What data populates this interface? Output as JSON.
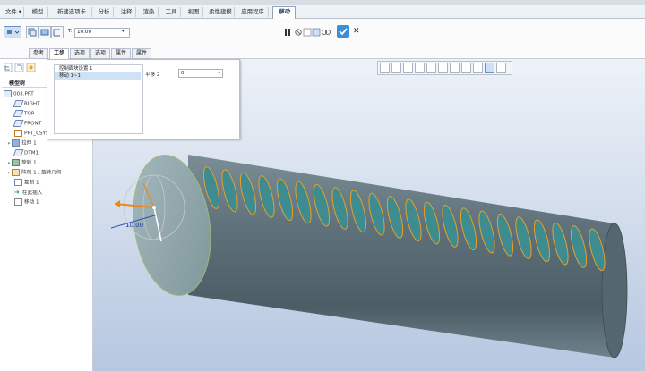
{
  "menubar": {
    "items": [
      "文件 ▾",
      "模型",
      "新建选项卡",
      "分析",
      "注释",
      "渲染",
      "工具",
      "视图",
      "柔性建模",
      "应用程序",
      "移动"
    ]
  },
  "ribbon": {
    "t_label": "T:",
    "t_value": "10.00",
    "subtabs": [
      "参考",
      "选项",
      "选项",
      "选项",
      "属性"
    ],
    "subtabs_visible": [
      "参考",
      "选项",
      "选项",
      "选项",
      "属性"
    ]
  },
  "subtabs": [
    "参考",
    "工步",
    "选项",
    "选项",
    "属性"
  ],
  "motion_panel": {
    "list_items": [
      "控制面块设置 1",
      "移动 1~1"
    ],
    "translate_label": "平移 2",
    "translate_value": "0"
  },
  "model_tree": {
    "title": "模型树",
    "items": [
      {
        "label": "003.PRT",
        "indent": 0
      },
      {
        "label": "RIGHT",
        "indent": 1
      },
      {
        "label": "TOP",
        "indent": 1
      },
      {
        "label": "FRONT",
        "indent": 1
      },
      {
        "label": "PRT_CSYS_DEF",
        "indent": 1
      },
      {
        "label": "拉伸 1",
        "indent": 1
      },
      {
        "label": "DTM1",
        "indent": 1
      },
      {
        "label": "旋转 1",
        "indent": 1
      },
      {
        "label": "阵列 1 / 旋转几何",
        "indent": 1
      },
      {
        "label": "复制 1",
        "indent": 1
      },
      {
        "label": "在此插入",
        "indent": 1
      },
      {
        "label": "移动 1",
        "indent": 1
      }
    ]
  },
  "viewport": {
    "dimension_label": "10.00"
  },
  "colors": {
    "viewport_top": "#e9eef6",
    "viewport_bottom": "#b9c9e2",
    "cylinder_body": "#5b6f78",
    "cylinder_face": "#8fa8ad",
    "slot_fill": "#3f8c90",
    "slot_outline": "#e6a027",
    "accent": "#3b8fd6"
  }
}
